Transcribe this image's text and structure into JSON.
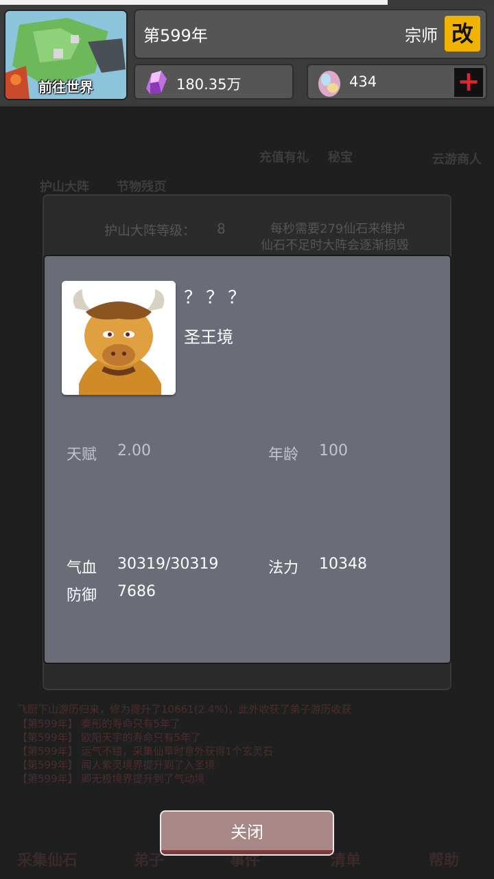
{
  "header": {
    "world_button_label": "前往世界",
    "year": "第599年",
    "rank": "宗师",
    "rename_label": "改",
    "spirit_stones": "180.35万",
    "gems": "434"
  },
  "background": {
    "top_icons": [
      "护山大阵",
      "节物残页",
      "充值有礼",
      "秘宝",
      "云游商人"
    ],
    "formation_level_label": "护山大阵等级：",
    "formation_level": "8",
    "upkeep_line1": "每秒需要279仙石来维护",
    "upkeep_line2": "仙石不足时大阵会逐渐损毁",
    "log_lines": [
      "飞厨下山游历归来，修为提升了10661(2.4%)，此外收获了弟子游历收获",
      "【第599年】 秦彤的寿命只有5年了",
      "【第599年】 欧阳天宇的寿命只有5年了",
      "【第599年】 运气不错，采集仙草时意外获得1个玄灵石",
      "【第599年】 闻人紫灵境界提升到了入圣境",
      "【第599年】 卿无极境界提升到了气动境"
    ],
    "bottom_nav": [
      "采集仙石",
      "弟子",
      "事件",
      "清单",
      "帮助"
    ]
  },
  "modal": {
    "name": "？？？",
    "realm": "圣王境",
    "talent_label": "天赋",
    "talent_value": "2.00",
    "age_label": "年龄",
    "age_value": "100",
    "hp_label": "气血",
    "hp_value": "30319/30319",
    "mana_label": "法力",
    "mana_value": "10348",
    "defense_label": "防御",
    "defense_value": "7686",
    "close_label": "关闭"
  },
  "colors": {
    "modal_bg": "#6a6c78",
    "rename_button": "#f0b400",
    "plus_icon": "#e8222a",
    "close_button": "#a78886"
  }
}
